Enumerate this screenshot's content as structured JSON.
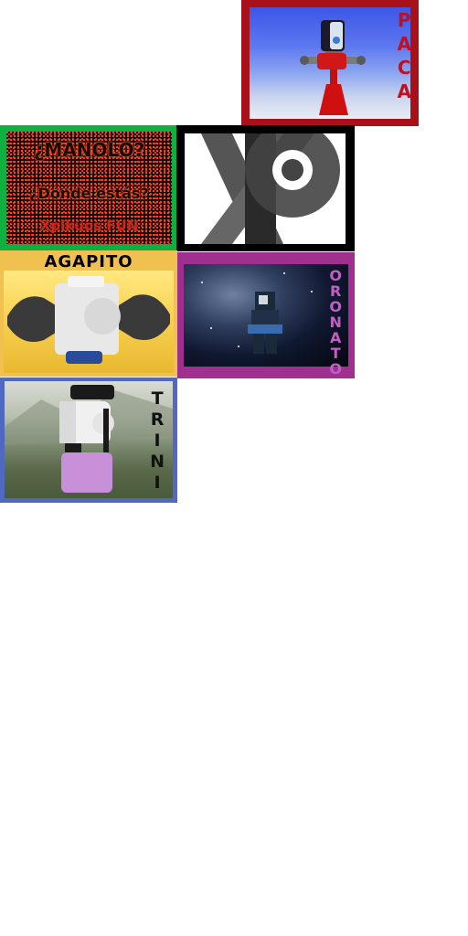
{
  "tiles": {
    "paca": {
      "letters": [
        "P",
        "A",
        "C",
        "A"
      ]
    },
    "manolo": {
      "line1": "¿MANOLO?",
      "line2": "¿Dónde estás?",
      "line3": "Xplkuos FUN"
    },
    "xp": {
      "logo": "xp-logo"
    },
    "agapito": {
      "title": "AGAPITO"
    },
    "oronato": {
      "letters": [
        "O",
        "R",
        "O",
        "N",
        "A",
        "T",
        "O"
      ]
    },
    "trini": {
      "letters": [
        "T",
        "R",
        "I",
        "N",
        "I"
      ]
    }
  },
  "colors": {
    "paca_border": "#a8101a",
    "manolo_border": "#10b040",
    "xp_border": "#000000",
    "agapito_border": "#f0c050",
    "oronato_border": "#a03090",
    "trini_border": "#5068c0"
  }
}
